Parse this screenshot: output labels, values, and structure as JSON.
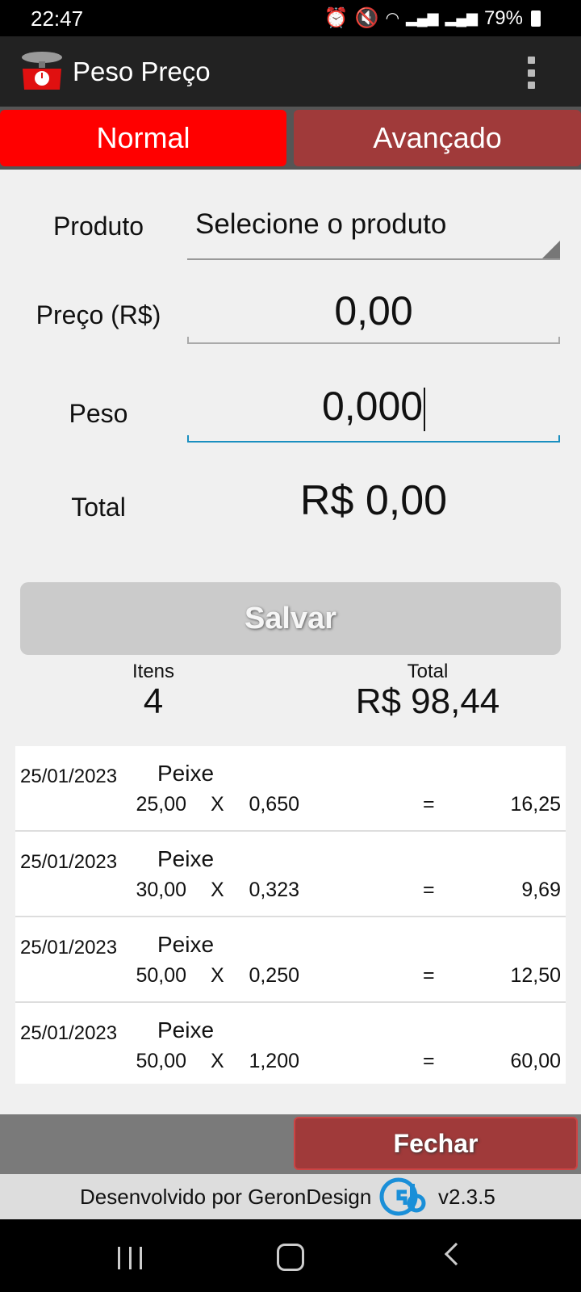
{
  "status_bar": {
    "time": "22:47",
    "battery": "79%",
    "icons": [
      "alarm-icon",
      "mute-icon",
      "wifi-icon",
      "signal-icon",
      "signal-icon",
      "battery-icon"
    ]
  },
  "app_bar": {
    "title": "Peso Preço",
    "logo_icon": "scale-icon",
    "menu_icon": "overflow-menu-icon"
  },
  "tabs": {
    "normal": "Normal",
    "advanced": "Avançado",
    "active": "Normal",
    "active_color": "#ff0000",
    "inactive_color": "#a03a3a"
  },
  "form": {
    "product_label": "Produto",
    "product_value": "Selecione o produto",
    "price_label": "Preço (R$)",
    "price_value": "0,00",
    "weight_label": "Peso",
    "weight_value": "0,000",
    "total_label": "Total",
    "total_value": "R$ 0,00",
    "save_label": "Salvar"
  },
  "summary": {
    "items_label": "Itens",
    "items_value": "4",
    "total_label": "Total",
    "total_value": "R$ 98,44"
  },
  "entries": [
    {
      "date": "25/01/2023",
      "product": "Peixe",
      "price": "25,00",
      "x": "X",
      "weight": "0,650",
      "eq": "=",
      "total": "16,25"
    },
    {
      "date": "25/01/2023",
      "product": "Peixe",
      "price": "30,00",
      "x": "X",
      "weight": "0,323",
      "eq": "=",
      "total": "9,69"
    },
    {
      "date": "25/01/2023",
      "product": "Peixe",
      "price": "50,00",
      "x": "X",
      "weight": "0,250",
      "eq": "=",
      "total": "12,50"
    },
    {
      "date": "25/01/2023",
      "product": "Peixe",
      "price": "50,00",
      "x": "X",
      "weight": "1,200",
      "eq": "=",
      "total": "60,00"
    }
  ],
  "footer": {
    "close_label": "Fechar",
    "credit": "Desenvolvido por GeronDesign",
    "version": "v2.3.5"
  }
}
